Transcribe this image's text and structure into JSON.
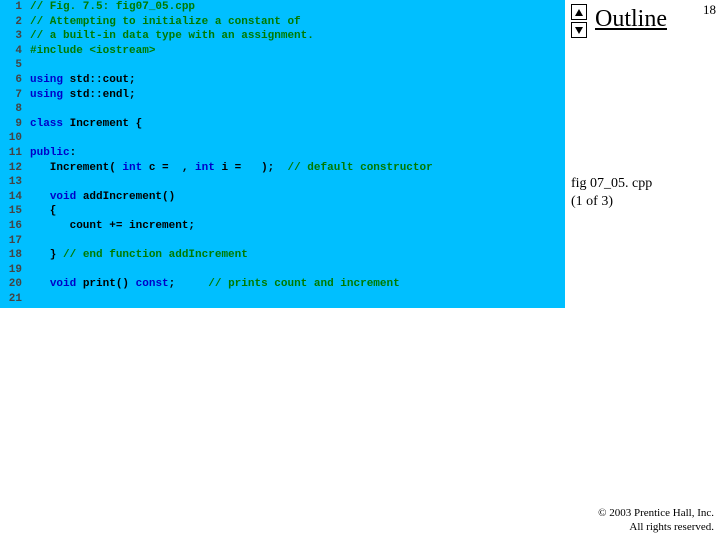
{
  "rightcol": {
    "outline_label": "Outline",
    "page_number": "18",
    "fig_name": "fig 07_05. cpp",
    "fig_part": "(1 of 3)",
    "copyright1": "© 2003 Prentice Hall, Inc.",
    "copyright2": "All rights reserved."
  },
  "code": {
    "lines": [
      {
        "ln": "1",
        "seg": [
          {
            "c": "c",
            "t": "// Fig. 7.5: fig07_05.cpp"
          }
        ]
      },
      {
        "ln": "2",
        "seg": [
          {
            "c": "c",
            "t": "// Attempting to initialize a constant of"
          }
        ]
      },
      {
        "ln": "3",
        "seg": [
          {
            "c": "c",
            "t": "// a built-in data type with an assignment."
          }
        ]
      },
      {
        "ln": "4",
        "seg": [
          {
            "c": "pp",
            "t": "#include <iostream>"
          }
        ]
      },
      {
        "ln": "5",
        "seg": []
      },
      {
        "ln": "6",
        "seg": [
          {
            "c": "k",
            "t": "using"
          },
          {
            "c": "",
            "t": " std::cout;"
          }
        ]
      },
      {
        "ln": "7",
        "seg": [
          {
            "c": "k",
            "t": "using"
          },
          {
            "c": "",
            "t": " std::endl;"
          }
        ]
      },
      {
        "ln": "8",
        "seg": []
      },
      {
        "ln": "9",
        "seg": [
          {
            "c": "k",
            "t": "class "
          },
          {
            "c": "",
            "t": "Increment {"
          }
        ]
      },
      {
        "ln": "10",
        "seg": []
      },
      {
        "ln": "11",
        "seg": [
          {
            "c": "k",
            "t": "public"
          },
          {
            "c": "",
            "t": ":"
          }
        ]
      },
      {
        "ln": "12",
        "seg": [
          {
            "c": "",
            "t": "   Increment( "
          },
          {
            "c": "k",
            "t": "int"
          },
          {
            "c": "",
            "t": " c =  , "
          },
          {
            "c": "k",
            "t": "int"
          },
          {
            "c": "",
            "t": " i =   );  "
          },
          {
            "c": "c",
            "t": "// default constructor"
          }
        ]
      },
      {
        "ln": "13",
        "seg": []
      },
      {
        "ln": "14",
        "seg": [
          {
            "c": "",
            "t": "   "
          },
          {
            "c": "k",
            "t": "void"
          },
          {
            "c": "",
            "t": " addIncrement()"
          }
        ]
      },
      {
        "ln": "15",
        "seg": [
          {
            "c": "",
            "t": "   {"
          }
        ]
      },
      {
        "ln": "16",
        "seg": [
          {
            "c": "",
            "t": "      count += increment;"
          }
        ]
      },
      {
        "ln": "17",
        "seg": []
      },
      {
        "ln": "18",
        "seg": [
          {
            "c": "",
            "t": "   } "
          },
          {
            "c": "c",
            "t": "// end function addIncrement"
          }
        ]
      },
      {
        "ln": "19",
        "seg": []
      },
      {
        "ln": "20",
        "seg": [
          {
            "c": "",
            "t": "   "
          },
          {
            "c": "k",
            "t": "void"
          },
          {
            "c": "",
            "t": " print() "
          },
          {
            "c": "k",
            "t": "const"
          },
          {
            "c": "",
            "t": ";     "
          },
          {
            "c": "c",
            "t": "// prints count and increment"
          }
        ]
      },
      {
        "ln": "21",
        "seg": []
      }
    ]
  }
}
